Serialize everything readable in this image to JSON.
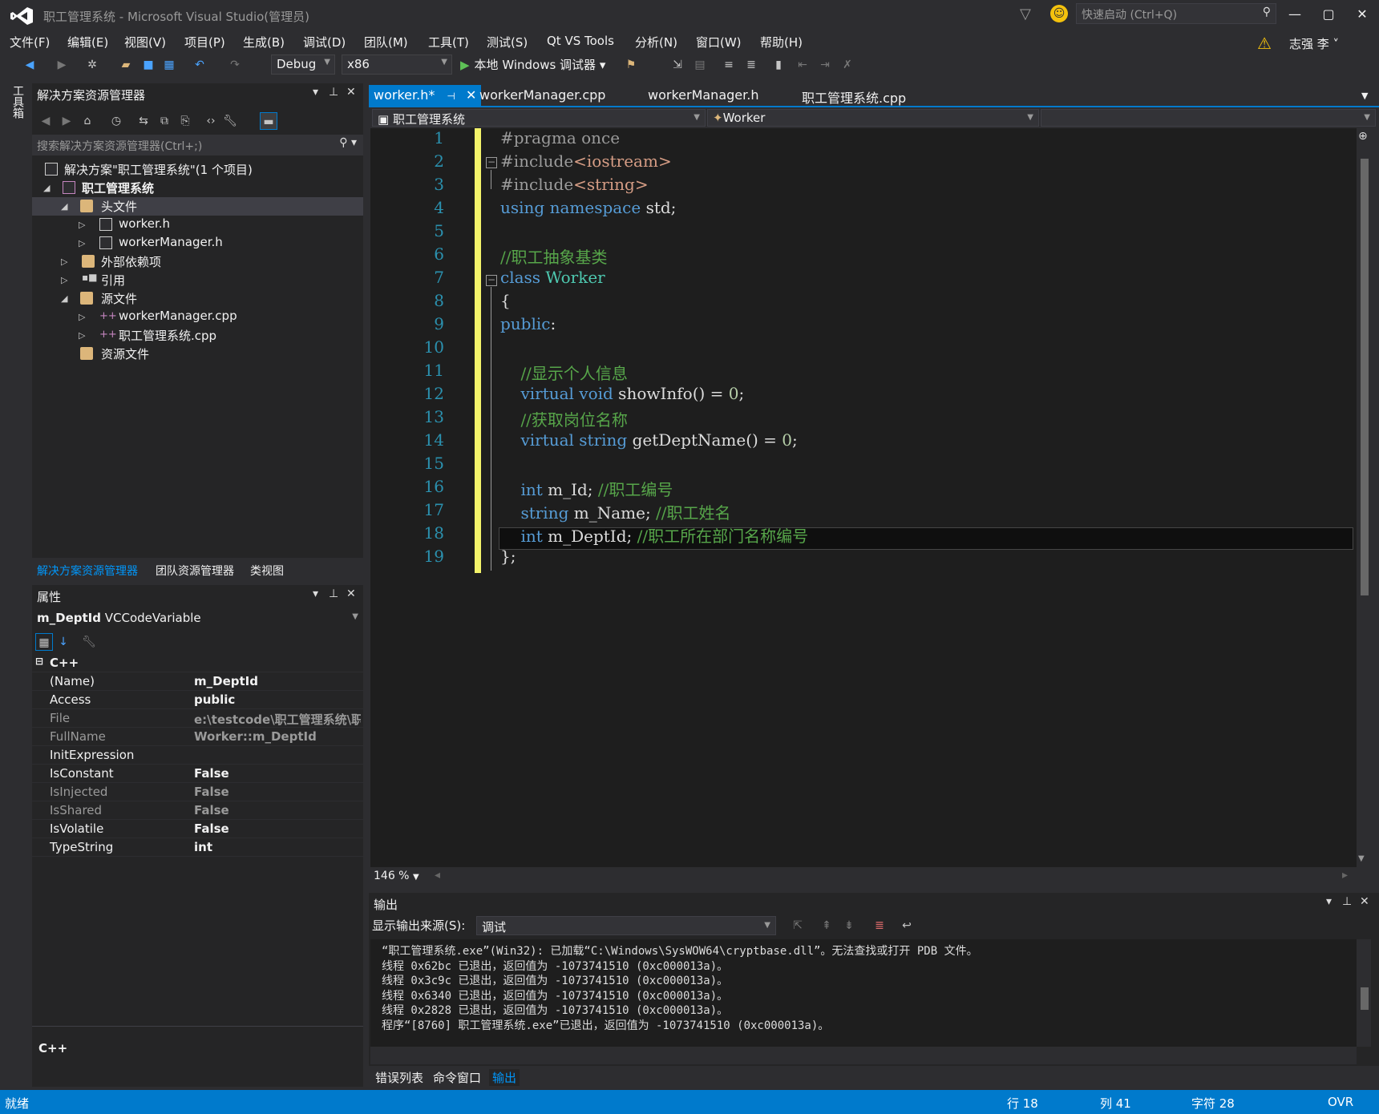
{
  "window": {
    "title": "职工管理系统 - Microsoft Visual Studio(管理员)",
    "quick_launch": "快速启动 (Ctrl+Q)",
    "user": "志强 李"
  },
  "menu": [
    "文件(F)",
    "编辑(E)",
    "视图(V)",
    "项目(P)",
    "生成(B)",
    "调试(D)",
    "团队(M)",
    "工具(T)",
    "测试(S)",
    "Qt VS Tools",
    "分析(N)",
    "窗口(W)",
    "帮助(H)"
  ],
  "toolbar": {
    "config": "Debug",
    "platform": "x86",
    "run_label": "本地 Windows 调试器"
  },
  "toolbox_label": "工具箱",
  "solution_explorer": {
    "title": "解决方案资源管理器",
    "search_placeholder": "搜索解决方案资源管理器(Ctrl+;)",
    "tree": [
      {
        "label": "解决方案\"职工管理系统\"(1 个项目)"
      },
      {
        "label": "职工管理系统"
      },
      {
        "label": "头文件"
      },
      {
        "label": "worker.h"
      },
      {
        "label": "workerManager.h"
      },
      {
        "label": "外部依赖项"
      },
      {
        "label": "引用"
      },
      {
        "label": "源文件"
      },
      {
        "label": "workerManager.cpp"
      },
      {
        "label": "职工管理系统.cpp"
      },
      {
        "label": "资源文件"
      }
    ],
    "bottom_tabs": [
      "解决方案资源管理器",
      "团队资源管理器",
      "类视图"
    ]
  },
  "properties": {
    "title": "属性",
    "object_name": "m_DeptId",
    "object_type": "VCCodeVariable",
    "category": "C++",
    "rows": [
      {
        "name": "(Name)",
        "value": "m_DeptId"
      },
      {
        "name": "Access",
        "value": "public"
      },
      {
        "name": "File",
        "value": "e:\\testcode\\职工管理系统\\职工"
      },
      {
        "name": "FullName",
        "value": "Worker::m_DeptId"
      },
      {
        "name": "InitExpression",
        "value": ""
      },
      {
        "name": "IsConstant",
        "value": "False"
      },
      {
        "name": "IsInjected",
        "value": "False"
      },
      {
        "name": "IsShared",
        "value": "False"
      },
      {
        "name": "IsVolatile",
        "value": "False"
      },
      {
        "name": "TypeString",
        "value": "int"
      }
    ],
    "description": "C++"
  },
  "editor": {
    "tabs": [
      "worker.h*",
      "workerManager.cpp",
      "workerManager.h",
      "职工管理系统.cpp"
    ],
    "nav_project": "职工管理系统",
    "nav_class": "Worker",
    "line_numbers": [
      "1",
      "2",
      "3",
      "4",
      "5",
      "6",
      "7",
      "8",
      "9",
      "10",
      "11",
      "12",
      "13",
      "14",
      "15",
      "16",
      "17",
      "18",
      "19"
    ],
    "zoom": "146 %"
  },
  "output": {
    "title": "输出",
    "source_label": "显示输出来源(S):",
    "source_value": "调试",
    "lines": [
      "“职工管理系统.exe”(Win32): 已加载“C:\\Windows\\SysWOW64\\cryptbase.dll”。无法查找或打开 PDB 文件。",
      "线程 0x62bc 已退出，返回值为 -1073741510 (0xc000013a)。",
      "线程 0x3c9c 已退出，返回值为 -1073741510 (0xc000013a)。",
      "线程 0x6340 已退出，返回值为 -1073741510 (0xc000013a)。",
      "线程 0x2828 已退出，返回值为 -1073741510 (0xc000013a)。",
      "程序“[8760] 职工管理系统.exe”已退出，返回值为 -1073741510 (0xc000013a)。"
    ],
    "tabs": [
      "错误列表",
      "命令窗口",
      "输出"
    ]
  },
  "status": {
    "ready": "就绪",
    "line": "行 18",
    "col": "列 41",
    "char": "字符 28",
    "mode": "OVR"
  }
}
